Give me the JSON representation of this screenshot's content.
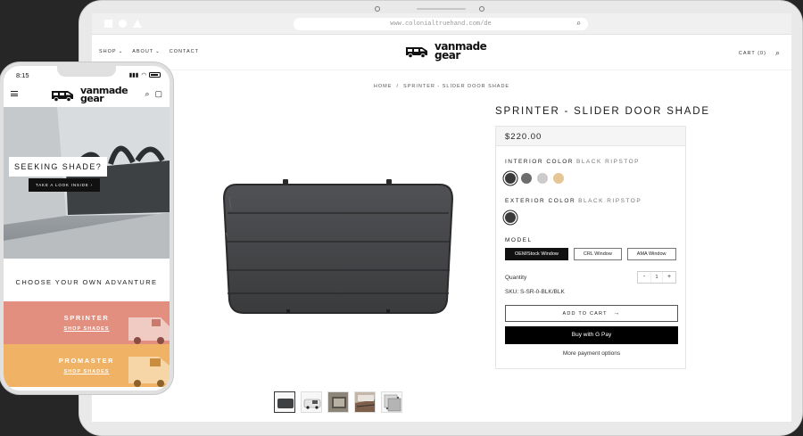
{
  "browser": {
    "url": "www.colonialtruehand.com/de"
  },
  "desktop": {
    "nav": {
      "shop": "SHOP",
      "about": "ABOUT",
      "contact": "CONTACT",
      "cart": "CART (0)"
    },
    "logo": {
      "line1": "vanmade",
      "line2": "gear"
    },
    "breadcrumb": {
      "home": "HOME",
      "sep": "/",
      "current": "SPRINTER - SLIDER DOOR SHADE"
    },
    "product": {
      "title": "SPRINTER - SLIDER DOOR SHADE",
      "price": "$220.00",
      "interior_label": "INTERIOR COLOR",
      "interior_value": "BLACK RIPSTOP",
      "interior_swatches": [
        "#3a3a3a",
        "#6d6e6c",
        "#cbcbcb",
        "#e6c597"
      ],
      "exterior_label": "EXTERIOR COLOR",
      "exterior_value": "BLACK RIPSTOP",
      "exterior_swatches": [
        "#3a3a3a"
      ],
      "model_label": "MODEL",
      "models": [
        "OEM/Stock Window",
        "CRL Window",
        "AMA Window"
      ],
      "quantity_label": "Quantity",
      "quantity_value": "1",
      "minus": "-",
      "plus": "+",
      "sku": "SKU: S-SR-0-BLK/BLK",
      "add_to_cart": "ADD TO CART",
      "buy_now": "Buy with G Pay",
      "more_payment": "More payment options"
    },
    "thumbnail_count": 5
  },
  "mobile": {
    "time": "8:15",
    "logo": {
      "line1": "vanmade",
      "line2": "gear"
    },
    "hero_title": "SEEKING SHADE?",
    "hero_button": "TAKE A LOOK INSIDE",
    "choose": "CHOOSE YOUR OWN ADVANTURE",
    "bands": [
      {
        "title": "SPRINTER",
        "link": "SHOP SHADES",
        "color": "#e38f7f"
      },
      {
        "title": "PROMASTER",
        "link": "SHOP SHADES",
        "color": "#f0b265"
      }
    ]
  },
  "colors": {
    "accent": "#111111",
    "background": "#262626"
  }
}
